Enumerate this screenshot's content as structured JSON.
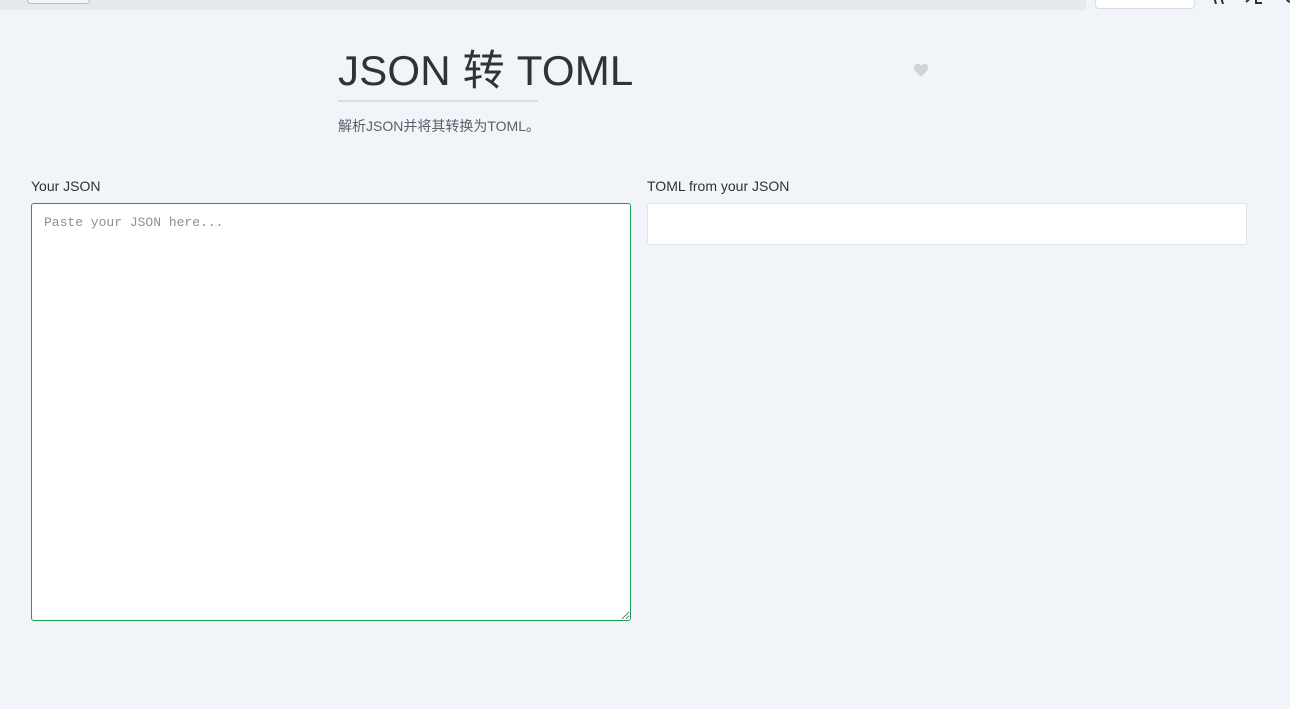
{
  "page": {
    "title": "JSON 转 TOML",
    "description": "解析JSON并将其转换为TOML。",
    "favorite_icon": "heart-icon"
  },
  "input_panel": {
    "label": "Your JSON",
    "placeholder": "Paste your JSON here...",
    "value": ""
  },
  "output_panel": {
    "label": "TOML from your JSON",
    "value": ""
  },
  "colors": {
    "background": "#f1f4f9",
    "accent": "#18a058",
    "favorite": "#d0d3d8"
  }
}
